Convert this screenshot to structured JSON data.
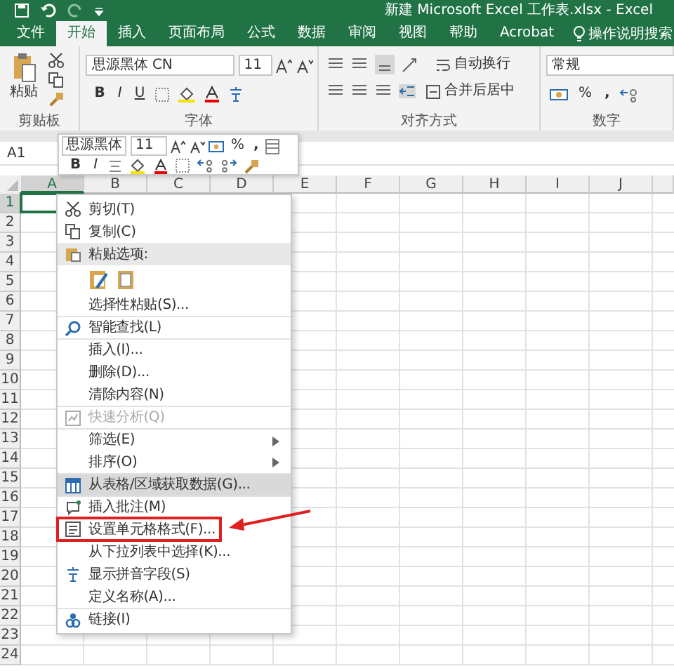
{
  "window": {
    "title": "新建 Microsoft Excel 工作表.xlsx  -  Excel"
  },
  "ribbon_tabs": [
    {
      "label": "文件",
      "selected": false
    },
    {
      "label": "开始",
      "selected": true
    },
    {
      "label": "插入",
      "selected": false
    },
    {
      "label": "页面布局",
      "selected": false
    },
    {
      "label": "公式",
      "selected": false
    },
    {
      "label": "数据",
      "selected": false
    },
    {
      "label": "审阅",
      "selected": false
    },
    {
      "label": "视图",
      "selected": false
    },
    {
      "label": "帮助",
      "selected": false
    },
    {
      "label": "Acrobat",
      "selected": false
    }
  ],
  "tell_me": "操作说明搜索",
  "ribbon": {
    "paste_label": "粘贴",
    "font_name": "思源黑体 CN",
    "font_size": "11",
    "bold": "B",
    "italic": "I",
    "underline": "U",
    "wrap_text": "自动换行",
    "merge_center": "合并后居中",
    "number_format": "常规",
    "percent": "%",
    "comma": ",",
    "group_labels": [
      "剪贴板",
      "字体",
      "对齐方式",
      "数字"
    ]
  },
  "name_box": "A1",
  "mini_toolbar": {
    "font_name": "思源黑体",
    "font_size": "11",
    "percent": "%",
    "comma": ",",
    "bold": "B",
    "italic": "I"
  },
  "columns": [
    {
      "label": "A",
      "selected": true
    },
    {
      "label": "B",
      "selected": false
    },
    {
      "label": "C",
      "selected": false
    },
    {
      "label": "D",
      "selected": false
    },
    {
      "label": "E",
      "selected": false
    },
    {
      "label": "F",
      "selected": false
    },
    {
      "label": "G",
      "selected": false
    },
    {
      "label": "H",
      "selected": false
    },
    {
      "label": "I",
      "selected": false
    },
    {
      "label": "J",
      "selected": false
    }
  ],
  "rows": [
    {
      "label": "1",
      "selected": true
    },
    {
      "label": "2",
      "selected": false
    },
    {
      "label": "3",
      "selected": false
    },
    {
      "label": "4",
      "selected": false
    },
    {
      "label": "5",
      "selected": false
    },
    {
      "label": "6",
      "selected": false
    },
    {
      "label": "7",
      "selected": false
    },
    {
      "label": "8",
      "selected": false
    },
    {
      "label": "9",
      "selected": false
    },
    {
      "label": "10",
      "selected": false
    },
    {
      "label": "11",
      "selected": false
    },
    {
      "label": "12",
      "selected": false
    },
    {
      "label": "13",
      "selected": false
    },
    {
      "label": "14",
      "selected": false
    },
    {
      "label": "15",
      "selected": false
    },
    {
      "label": "16",
      "selected": false
    },
    {
      "label": "17",
      "selected": false
    },
    {
      "label": "18",
      "selected": false
    },
    {
      "label": "19",
      "selected": false
    },
    {
      "label": "20",
      "selected": false
    },
    {
      "label": "21",
      "selected": false
    },
    {
      "label": "22",
      "selected": false
    },
    {
      "label": "23",
      "selected": false
    },
    {
      "label": "24",
      "selected": false
    }
  ],
  "context_menu": {
    "items": [
      {
        "kind": "item",
        "label": "剪切(T)",
        "disabled": false,
        "hovered": false
      },
      {
        "kind": "item",
        "label": "复制(C)",
        "disabled": false,
        "hovered": false
      },
      {
        "kind": "header",
        "label": "粘贴选项:"
      },
      {
        "kind": "paste_options"
      },
      {
        "kind": "item",
        "label": "选择性粘贴(S)...",
        "disabled": false,
        "hovered": false
      },
      {
        "kind": "item",
        "label": "智能查找(L)",
        "disabled": false,
        "hovered": false,
        "separator_before": true
      },
      {
        "kind": "item",
        "label": "插入(I)...",
        "disabled": false,
        "hovered": false,
        "separator_before": true
      },
      {
        "kind": "item",
        "label": "删除(D)...",
        "disabled": false,
        "hovered": false
      },
      {
        "kind": "item",
        "label": "清除内容(N)",
        "disabled": false,
        "hovered": false
      },
      {
        "kind": "item",
        "label": "快速分析(Q)",
        "disabled": true,
        "hovered": false,
        "separator_before": true
      },
      {
        "kind": "submenu",
        "label": "筛选(E)",
        "disabled": false,
        "hovered": false,
        "separator_before": true
      },
      {
        "kind": "submenu",
        "label": "排序(O)",
        "disabled": false,
        "hovered": false
      },
      {
        "kind": "item",
        "label": "从表格/区域获取数据(G)...",
        "disabled": false,
        "hovered": true,
        "separator_before": true
      },
      {
        "kind": "item",
        "label": "插入批注(M)",
        "disabled": false,
        "hovered": false,
        "separator_before": true
      },
      {
        "kind": "item",
        "label": "设置单元格格式(F)...",
        "disabled": false,
        "hovered": false,
        "annotated": true
      },
      {
        "kind": "item",
        "label": "从下拉列表中选择(K)...",
        "disabled": false,
        "hovered": false
      },
      {
        "kind": "item",
        "label": "显示拼音字段(S)",
        "disabled": false,
        "hovered": false
      },
      {
        "kind": "item",
        "label": "定义名称(A)...",
        "disabled": false,
        "hovered": false
      },
      {
        "kind": "item",
        "label": "链接(I)",
        "disabled": false,
        "hovered": false,
        "separator_before": true
      }
    ]
  }
}
